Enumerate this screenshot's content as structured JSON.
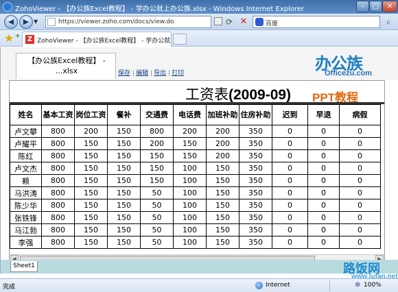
{
  "window": {
    "title": "ZohoViewer - 【办公族Excel教程】 - 学办公就上办公族.xlsx - Windows Internet Explorer",
    "min": "–",
    "max": "□",
    "close": "✕"
  },
  "address": {
    "url": "https://viewer.zoho.com/docs/view.do",
    "search_engine": "百度"
  },
  "browser_tab": {
    "icon_letter": "Z",
    "title": "ZohoViewer - 【办公族Excel教程】 - 学办公就上..."
  },
  "doc": {
    "tab_name_line1": "【办公族Excel教程】 -",
    "tab_name_line2": "...xlsx",
    "actions": [
      "保存",
      "编辑",
      "导出",
      "打印"
    ],
    "logo_cn": "办公族",
    "logo_en": "Officezu.com"
  },
  "sheet": {
    "title_cn": "工资表",
    "title_year": "(2009-09)",
    "banner": "PPT教程",
    "headers": [
      "姓名",
      "基本工资",
      "岗位工资",
      "餐补",
      "交通费",
      "电话费",
      "加班补助",
      "住房补助",
      "迟到",
      "早退",
      "病假"
    ],
    "rows": [
      [
        "卢文攀",
        "800",
        "200",
        "150",
        "800",
        "200",
        "200",
        "350",
        "0",
        "0",
        "0"
      ],
      [
        "卢耀平",
        "800",
        "150",
        "150",
        "200",
        "150",
        "200",
        "350",
        "0",
        "0",
        "0"
      ],
      [
        "陈红",
        "800",
        "150",
        "150",
        "150",
        "150",
        "200",
        "350",
        "0",
        "0",
        "0"
      ],
      [
        "卢文杰",
        "800",
        "150",
        "150",
        "150",
        "100",
        "150",
        "350",
        "0",
        "0",
        "0"
      ],
      [
        "赖",
        "800",
        "150",
        "150",
        "150",
        "100",
        "150",
        "350",
        "0",
        "0",
        "0"
      ],
      [
        "马洪涛",
        "800",
        "150",
        "150",
        "50",
        "100",
        "150",
        "350",
        "0",
        "0",
        "0"
      ],
      [
        "陈少华",
        "800",
        "150",
        "150",
        "50",
        "100",
        "150",
        "350",
        "0",
        "0",
        "0"
      ],
      [
        "张铁锋",
        "800",
        "150",
        "150",
        "50",
        "100",
        "150",
        "350",
        "0",
        "0",
        "0"
      ],
      [
        "马江勃",
        "800",
        "150",
        "150",
        "50",
        "100",
        "150",
        "350",
        "0",
        "0",
        "0"
      ],
      [
        "李强",
        "800",
        "150",
        "150",
        "50",
        "100",
        "150",
        "350",
        "0",
        "0",
        "0"
      ]
    ],
    "tab": "Sheet1"
  },
  "status": {
    "text": "完成",
    "zone": "Internet",
    "zoom": "100%"
  },
  "watermark": {
    "cn": "路饭网",
    "en": "www.lufan.net"
  }
}
